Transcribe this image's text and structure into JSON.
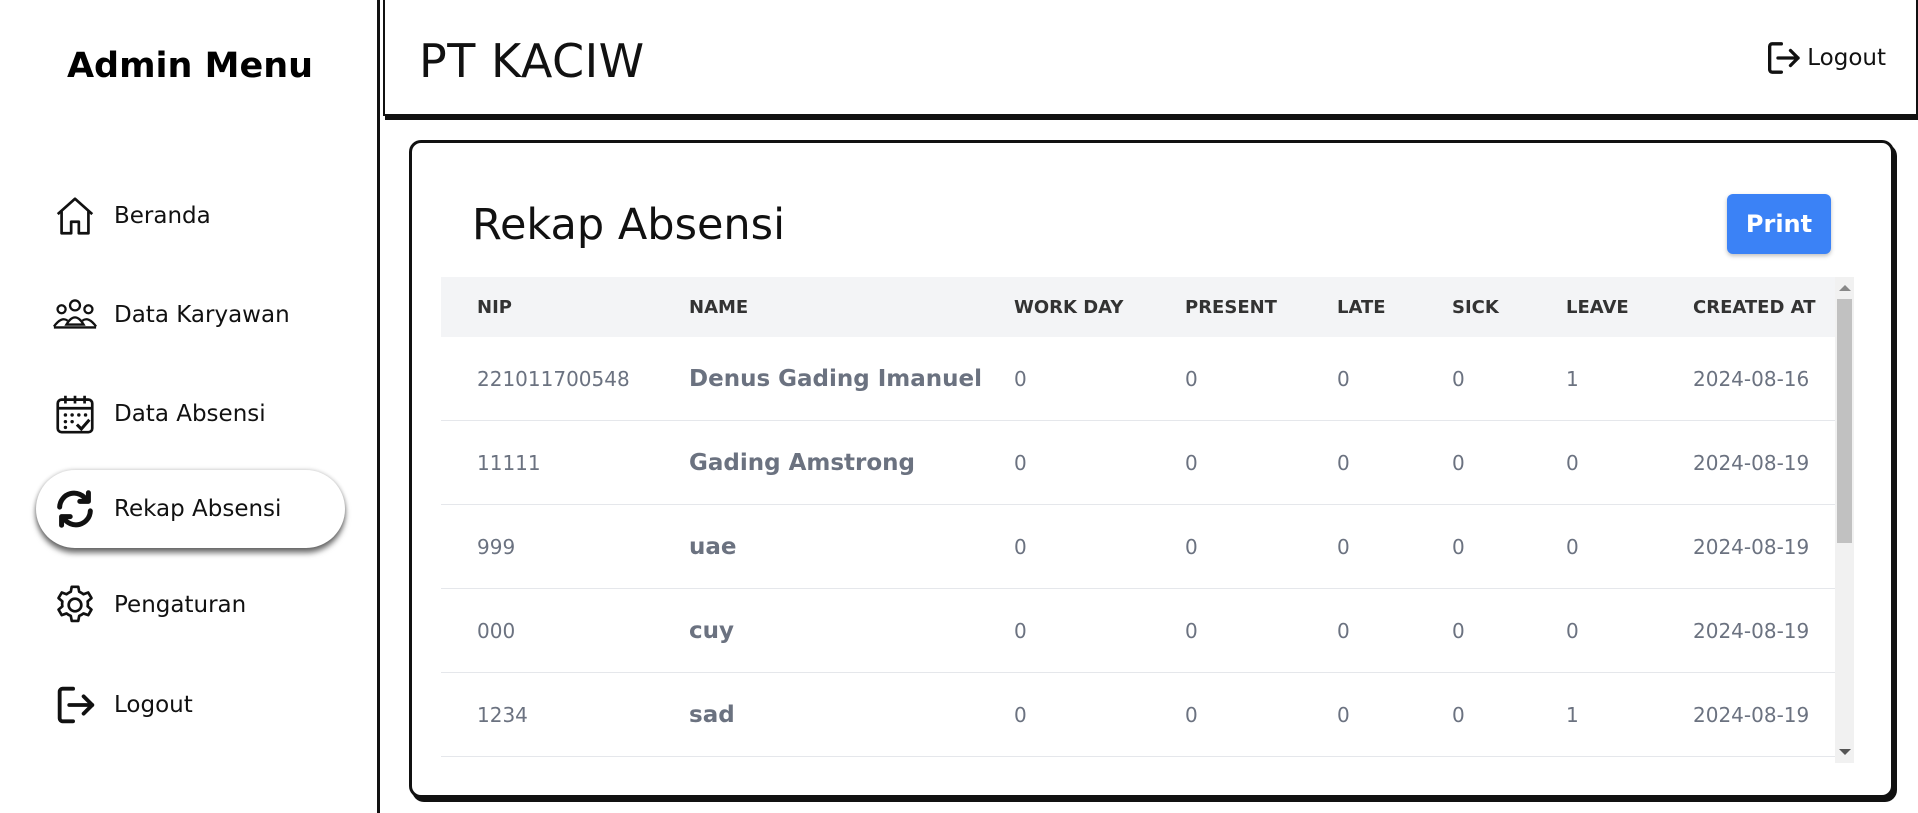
{
  "sidebar": {
    "title": "Admin Menu",
    "items": [
      {
        "label": "Beranda",
        "icon": "home-icon"
      },
      {
        "label": "Data Karyawan",
        "icon": "users-icon"
      },
      {
        "label": "Data Absensi",
        "icon": "calendar-icon"
      },
      {
        "label": "Rekap Absensi",
        "icon": "refresh-icon",
        "active": true
      },
      {
        "label": "Pengaturan",
        "icon": "gear-icon"
      },
      {
        "label": "Logout",
        "icon": "logout-icon"
      }
    ]
  },
  "header": {
    "company": "PT KACIW",
    "logout_label": "Logout"
  },
  "main": {
    "title": "Rekap Absensi",
    "print_label": "Print",
    "accent_color": "#3b82f6",
    "table": {
      "columns": [
        "NIP",
        "NAME",
        "WORK DAY",
        "PRESENT",
        "LATE",
        "SICK",
        "LEAVE",
        "CREATED AT"
      ],
      "rows": [
        {
          "nip": "221011700548",
          "name": "Denus Gading Imanuel",
          "work_day": "0",
          "present": "0",
          "late": "0",
          "sick": "0",
          "leave": "1",
          "created_at": "2024-08-16"
        },
        {
          "nip": "11111",
          "name": "Gading Amstrong",
          "work_day": "0",
          "present": "0",
          "late": "0",
          "sick": "0",
          "leave": "0",
          "created_at": "2024-08-19"
        },
        {
          "nip": "999",
          "name": "uae",
          "work_day": "0",
          "present": "0",
          "late": "0",
          "sick": "0",
          "leave": "0",
          "created_at": "2024-08-19"
        },
        {
          "nip": "000",
          "name": "cuy",
          "work_day": "0",
          "present": "0",
          "late": "0",
          "sick": "0",
          "leave": "0",
          "created_at": "2024-08-19"
        },
        {
          "nip": "1234",
          "name": "sad",
          "work_day": "0",
          "present": "0",
          "late": "0",
          "sick": "0",
          "leave": "1",
          "created_at": "2024-08-19"
        }
      ]
    }
  }
}
